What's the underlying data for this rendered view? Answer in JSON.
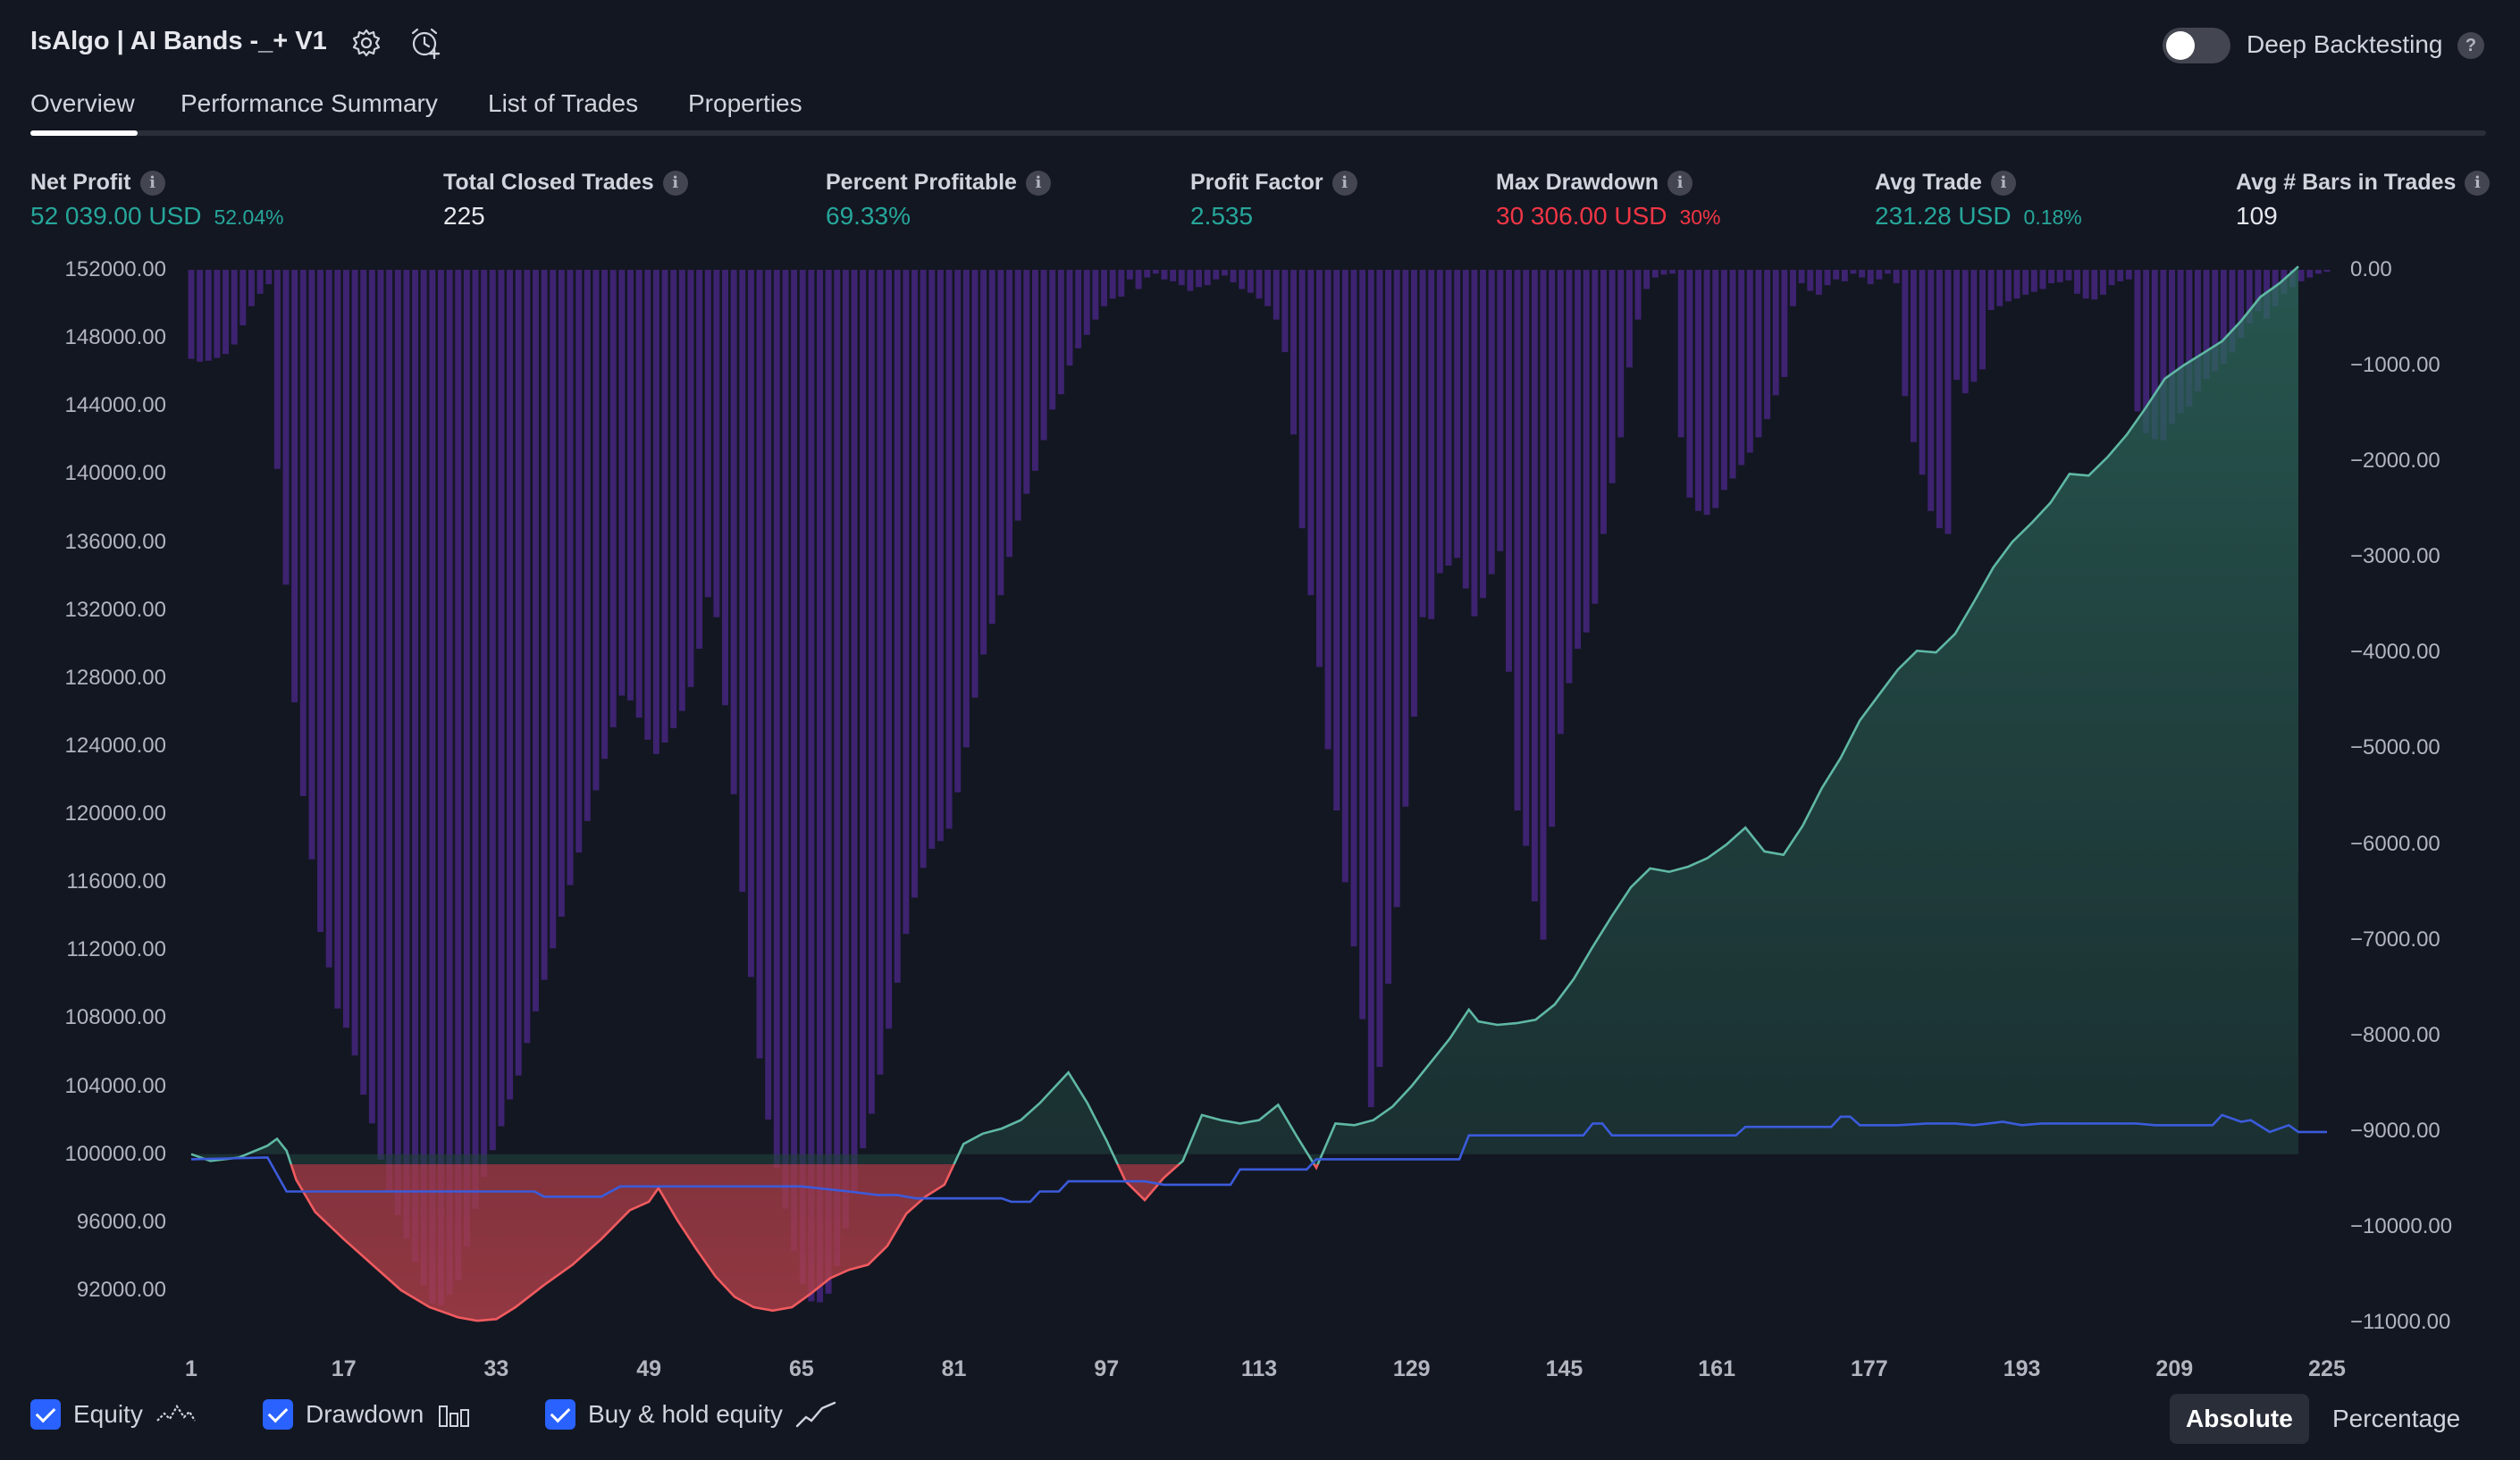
{
  "header": {
    "title": "IsAlgo | AI Bands -_+ V1",
    "deep_backtesting_label": "Deep Backtesting",
    "deep_backtesting_enabled": false,
    "help_glyph": "?",
    "icons": [
      "gear-icon",
      "alarm-add-icon",
      "help-icon"
    ]
  },
  "tabs": [
    {
      "label": "Overview",
      "active": true
    },
    {
      "label": "Performance Summary",
      "active": false
    },
    {
      "label": "List of Trades",
      "active": false
    },
    {
      "label": "Properties",
      "active": false
    }
  ],
  "stats": {
    "info_glyph": "i",
    "net_profit": {
      "label": "Net Profit",
      "value": "52 039.00 USD",
      "sub": "52.04%"
    },
    "total_closed_trades": {
      "label": "Total Closed Trades",
      "value": "225"
    },
    "percent_profitable": {
      "label": "Percent Profitable",
      "value": "69.33%"
    },
    "profit_factor": {
      "label": "Profit Factor",
      "value": "2.535"
    },
    "max_drawdown": {
      "label": "Max Drawdown",
      "value": "30 306.00 USD",
      "sub": "30%"
    },
    "avg_trade": {
      "label": "Avg Trade",
      "value": "231.28 USD",
      "sub": "0.18%"
    },
    "avg_bars": {
      "label": "Avg # Bars in Trades",
      "value": "109"
    }
  },
  "colors": {
    "background": "#131722",
    "profit": "#26a69a",
    "loss": "#f23645",
    "equity_above": "#5fb8a4",
    "equity_below": "#f05b5f",
    "buy_hold": "#3b5bdb",
    "drawdown_bars": "#3e2371",
    "accent": "#2962ff"
  },
  "legend": {
    "equity": "Equity",
    "drawdown": "Drawdown",
    "buy_hold": "Buy & hold equity"
  },
  "toggles": {
    "absolute": "Absolute",
    "percentage": "Percentage",
    "selected": "absolute"
  },
  "chart_data": {
    "type": "line",
    "x_label_ticks": [
      "1",
      "17",
      "33",
      "49",
      "65",
      "81",
      "97",
      "113",
      "129",
      "145",
      "161",
      "177",
      "193",
      "209",
      "225"
    ],
    "xlim": [
      1,
      225
    ],
    "left_ticks": [
      "152000.00",
      "148000.00",
      "144000.00",
      "140000.00",
      "136000.00",
      "132000.00",
      "128000.00",
      "124000.00",
      "120000.00",
      "116000.00",
      "112000.00",
      "108000.00",
      "104000.00",
      "100000.00",
      "96000.00",
      "92000.00"
    ],
    "right_ticks": [
      "0.00",
      "−1000.00",
      "−2000.00",
      "−3000.00",
      "−4000.00",
      "−5000.00",
      "−6000.00",
      "−7000.00",
      "−8000.00",
      "−9000.00",
      "−10000.00",
      "−11000.00"
    ],
    "ylim_left": [
      90000,
      152000
    ],
    "ylim_right": [
      -11000,
      0
    ],
    "baseline": 100000,
    "series": [
      {
        "name": "Equity",
        "axis": "left",
        "points": [
          [
            1,
            100000
          ],
          [
            3,
            99600
          ],
          [
            6,
            99800
          ],
          [
            9,
            100500
          ],
          [
            10,
            100900
          ],
          [
            11,
            100200
          ],
          [
            12,
            98500
          ],
          [
            14,
            96600
          ],
          [
            17,
            95000
          ],
          [
            20,
            93500
          ],
          [
            23,
            92000
          ],
          [
            26,
            91000
          ],
          [
            29,
            90400
          ],
          [
            31,
            90200
          ],
          [
            33,
            90300
          ],
          [
            35,
            91000
          ],
          [
            38,
            92300
          ],
          [
            41,
            93500
          ],
          [
            44,
            95000
          ],
          [
            47,
            96700
          ],
          [
            49,
            97200
          ],
          [
            50,
            98000
          ],
          [
            52,
            96100
          ],
          [
            54,
            94400
          ],
          [
            56,
            92800
          ],
          [
            58,
            91600
          ],
          [
            60,
            91000
          ],
          [
            62,
            90800
          ],
          [
            64,
            91000
          ],
          [
            66,
            91800
          ],
          [
            68,
            92700
          ],
          [
            70,
            93200
          ],
          [
            72,
            93500
          ],
          [
            74,
            94600
          ],
          [
            76,
            96500
          ],
          [
            78,
            97500
          ],
          [
            80,
            98200
          ],
          [
            82,
            100600
          ],
          [
            84,
            101200
          ],
          [
            86,
            101500
          ],
          [
            88,
            102000
          ],
          [
            90,
            103000
          ],
          [
            92,
            104200
          ],
          [
            93,
            104800
          ],
          [
            95,
            103000
          ],
          [
            97,
            100800
          ],
          [
            99,
            98400
          ],
          [
            101,
            97300
          ],
          [
            103,
            98600
          ],
          [
            105,
            99600
          ],
          [
            107,
            102300
          ],
          [
            109,
            102000
          ],
          [
            111,
            101800
          ],
          [
            113,
            102000
          ],
          [
            115,
            102900
          ],
          [
            117,
            101000
          ],
          [
            119,
            99200
          ],
          [
            121,
            101800
          ],
          [
            123,
            101700
          ],
          [
            125,
            102000
          ],
          [
            127,
            102800
          ],
          [
            129,
            104000
          ],
          [
            131,
            105400
          ],
          [
            133,
            106800
          ],
          [
            135,
            108500
          ],
          [
            136,
            107800
          ],
          [
            138,
            107600
          ],
          [
            140,
            107700
          ],
          [
            142,
            107900
          ],
          [
            144,
            108800
          ],
          [
            146,
            110300
          ],
          [
            148,
            112200
          ],
          [
            150,
            114000
          ],
          [
            152,
            115700
          ],
          [
            154,
            116800
          ],
          [
            156,
            116600
          ],
          [
            158,
            116900
          ],
          [
            160,
            117400
          ],
          [
            162,
            118200
          ],
          [
            164,
            119200
          ],
          [
            166,
            117800
          ],
          [
            168,
            117600
          ],
          [
            170,
            119300
          ],
          [
            172,
            121500
          ],
          [
            174,
            123300
          ],
          [
            176,
            125500
          ],
          [
            178,
            127000
          ],
          [
            180,
            128500
          ],
          [
            182,
            129600
          ],
          [
            184,
            129500
          ],
          [
            186,
            130600
          ],
          [
            188,
            132500
          ],
          [
            190,
            134500
          ],
          [
            192,
            136000
          ],
          [
            194,
            137100
          ],
          [
            196,
            138300
          ],
          [
            198,
            140000
          ],
          [
            200,
            139900
          ],
          [
            202,
            141000
          ],
          [
            204,
            142300
          ],
          [
            206,
            143900
          ],
          [
            208,
            145600
          ],
          [
            210,
            146400
          ],
          [
            212,
            147100
          ],
          [
            214,
            147800
          ],
          [
            216,
            149000
          ],
          [
            218,
            150400
          ],
          [
            220,
            151200
          ],
          [
            222,
            152200
          ]
        ]
      },
      {
        "name": "Buy & hold equity",
        "axis": "left",
        "points": [
          [
            1,
            99700
          ],
          [
            9,
            99800
          ],
          [
            11,
            97800
          ],
          [
            21,
            97800
          ],
          [
            31,
            97800
          ],
          [
            37,
            97800
          ],
          [
            38,
            97500
          ],
          [
            44,
            97500
          ],
          [
            46,
            98100
          ],
          [
            55,
            98100
          ],
          [
            65,
            98100
          ],
          [
            70,
            97800
          ],
          [
            73,
            97600
          ],
          [
            75,
            97600
          ],
          [
            77,
            97400
          ],
          [
            83,
            97400
          ],
          [
            86,
            97400
          ],
          [
            87,
            97200
          ],
          [
            89,
            97200
          ],
          [
            90,
            97800
          ],
          [
            92,
            97800
          ],
          [
            93,
            98400
          ],
          [
            99,
            98400
          ],
          [
            101,
            98400
          ],
          [
            103,
            98200
          ],
          [
            110,
            98200
          ],
          [
            111,
            99100
          ],
          [
            116,
            99100
          ],
          [
            118,
            99100
          ],
          [
            119,
            99700
          ],
          [
            129,
            99700
          ],
          [
            131,
            99700
          ],
          [
            134,
            99700
          ],
          [
            135,
            101100
          ],
          [
            147,
            101100
          ],
          [
            148,
            101800
          ],
          [
            149,
            101800
          ],
          [
            150,
            101100
          ],
          [
            155,
            101100
          ],
          [
            163,
            101100
          ],
          [
            164,
            101600
          ],
          [
            171,
            101600
          ],
          [
            173,
            101600
          ],
          [
            174,
            102200
          ],
          [
            175,
            102200
          ],
          [
            176,
            101700
          ],
          [
            180,
            101700
          ],
          [
            183,
            101800
          ],
          [
            186,
            101800
          ],
          [
            188,
            101700
          ],
          [
            191,
            101900
          ],
          [
            193,
            101700
          ],
          [
            195,
            101800
          ],
          [
            201,
            101800
          ],
          [
            205,
            101800
          ],
          [
            207,
            101700
          ],
          [
            213,
            101700
          ],
          [
            214,
            102300
          ],
          [
            216,
            101900
          ],
          [
            217,
            102000
          ],
          [
            219,
            101300
          ],
          [
            221,
            101700
          ],
          [
            222,
            101300
          ],
          [
            225,
            101300
          ]
        ]
      },
      {
        "name": "Drawdown",
        "axis": "right",
        "type": "bar",
        "values": [
          -930,
          -960,
          -950,
          -920,
          -880,
          -780,
          -580,
          -380,
          -250,
          -150,
          -2080,
          -3290,
          -4520,
          -5500,
          -6160,
          -6920,
          -7290,
          -7720,
          -7920,
          -8210,
          -8620,
          -8920,
          -9300,
          -9640,
          -9880,
          -10120,
          -10370,
          -10610,
          -10800,
          -10820,
          -10710,
          -10560,
          -10210,
          -9810,
          -9480,
          -9200,
          -8950,
          -8670,
          -8420,
          -8080,
          -7750,
          -7420,
          -7090,
          -6760,
          -6430,
          -6090,
          -5760,
          -5440,
          -5110,
          -4780,
          -4450,
          -4500,
          -4680,
          -4910,
          -5060,
          -4940,
          -4790,
          -4610,
          -4360,
          -3960,
          -3420,
          -3630,
          -4550,
          -5480,
          -6500,
          -7390,
          -8240,
          -8880,
          -9390,
          -9810,
          -10250,
          -10600,
          -10780,
          -10790,
          -10700,
          -10410,
          -10020,
          -9650,
          -9180,
          -8820,
          -8410,
          -7930,
          -7450,
          -6940,
          -6560,
          -6250,
          -6050,
          -5970,
          -5840,
          -5460,
          -4990,
          -4470,
          -4020,
          -3700,
          -3400,
          -3000,
          -2620,
          -2340,
          -2100,
          -1780,
          -1460,
          -1300,
          -1000,
          -820,
          -680,
          -520,
          -380,
          -300,
          -280,
          -100,
          -200,
          -80,
          -40,
          -100,
          -120,
          -160,
          -220,
          -180,
          -160,
          -100,
          -60,
          -130,
          -200,
          -240,
          -300,
          -380,
          -520,
          -860,
          -1720,
          -2700,
          -3400,
          -4150,
          -5010,
          -5650,
          -6400,
          -7070,
          -7830,
          -8750,
          -8330,
          -7460,
          -6660,
          -5610,
          -4670,
          -3630,
          -3650,
          -3170,
          -3090,
          -3010,
          -3330,
          -3620,
          -3430,
          -3180,
          -2940,
          -4200,
          -5650,
          -6020,
          -6600,
          -7000,
          -5820,
          -4850,
          -4320,
          -3960,
          -3790,
          -3490,
          -2760,
          -2230,
          -1750,
          -1020,
          -520,
          -200,
          -80,
          -50,
          -40,
          -1750,
          -2380,
          -2520,
          -2560,
          -2490,
          -2300,
          -2180,
          -2040,
          -1910,
          -1750,
          -1560,
          -1310,
          -1120,
          -380,
          -140,
          -220,
          -260,
          -160,
          -100,
          -120,
          -40,
          -80,
          -150,
          -100,
          -40,
          -140,
          -1320,
          -1800,
          -2140,
          -2520,
          -2700,
          -2760,
          -1150,
          -1290,
          -1170,
          -1040,
          -420,
          -380,
          -330,
          -300,
          -260,
          -230,
          -200,
          -140,
          -130,
          -110,
          -250,
          -300,
          -310,
          -260,
          -160,
          -120,
          -100,
          -1480,
          -1710,
          -1770,
          -1780,
          -1610,
          -1500,
          -1430,
          -1270,
          -1140,
          -1060,
          -980,
          -860,
          -710,
          -560,
          -430,
          -510,
          -380,
          -250,
          -180,
          -120,
          -80,
          -40,
          -20
        ]
      }
    ]
  }
}
